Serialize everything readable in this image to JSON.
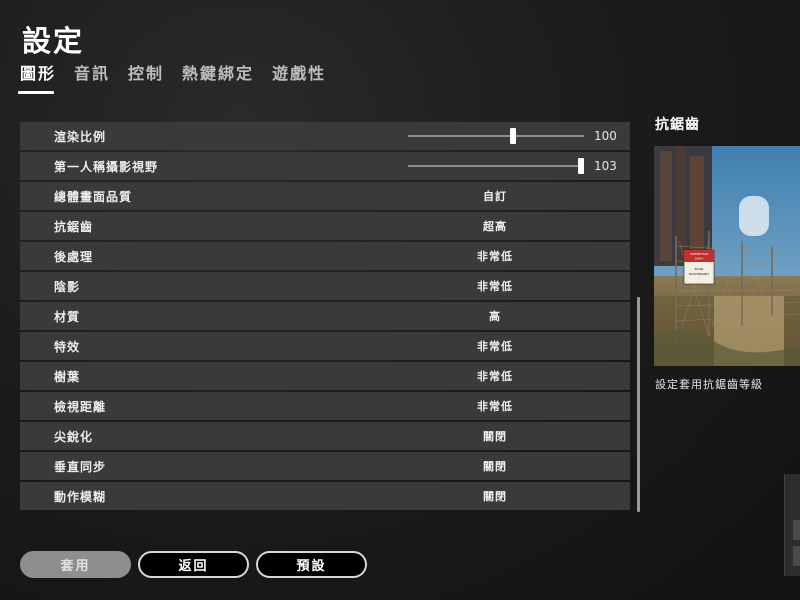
{
  "header": {
    "title": "設定"
  },
  "tabs": [
    {
      "label": "圖形",
      "active": true
    },
    {
      "label": "音訊",
      "active": false
    },
    {
      "label": "控制",
      "active": false
    },
    {
      "label": "熱鍵綁定",
      "active": false
    },
    {
      "label": "遊戲性",
      "active": false
    }
  ],
  "settings": {
    "sliders": [
      {
        "label": "渲染比例",
        "value": "100",
        "fraction": 0.6
      },
      {
        "label": "第一人稱攝影視野",
        "value": "103",
        "fraction": 1.0
      }
    ],
    "options": [
      {
        "label": "總體畫面品質",
        "value": "自訂"
      },
      {
        "label": "抗鋸齒",
        "value": "超高"
      },
      {
        "label": "後處理",
        "value": "非常低"
      },
      {
        "label": "陰影",
        "value": "非常低"
      },
      {
        "label": "材質",
        "value": "高"
      },
      {
        "label": "特效",
        "value": "非常低"
      },
      {
        "label": "樹葉",
        "value": "非常低"
      },
      {
        "label": "檢視距離",
        "value": "非常低"
      },
      {
        "label": "尖銳化",
        "value": "關閉"
      },
      {
        "label": "垂直同步",
        "value": "關閉"
      },
      {
        "label": "動作模糊",
        "value": "關閉"
      }
    ]
  },
  "preview": {
    "title": "抗鋸齒",
    "caption": "設定套用抗鋸齒等級",
    "sign_text": [
      "ЗАПРЕТНАЯ",
      "ЗОНА",
      "ВХОД",
      "ВОСПРЕЩЁН"
    ]
  },
  "buttons": {
    "apply": "套用",
    "back": "返回",
    "defaults": "預設"
  },
  "colors": {
    "row_bg": "#3a3a3a",
    "apply_bg": "#8e8e8e",
    "accent": "#ffffff"
  }
}
